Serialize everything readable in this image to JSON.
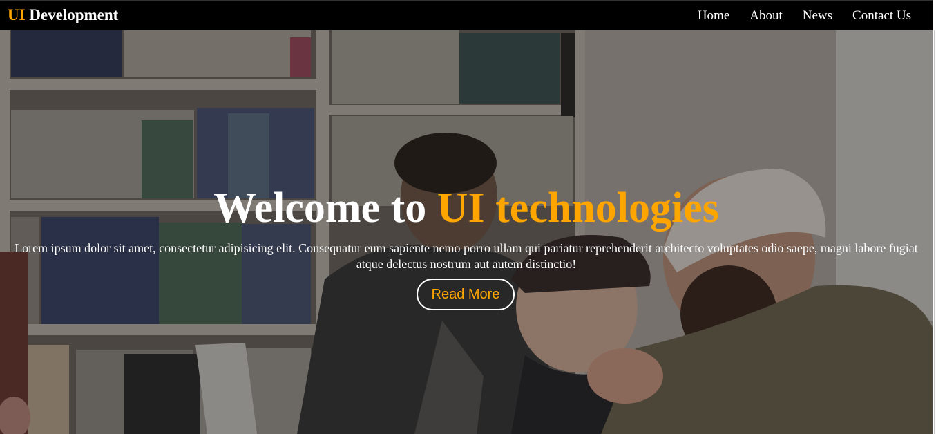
{
  "navbar": {
    "brand_accent": "UI",
    "brand_rest": " Development",
    "links": [
      {
        "label": "Home"
      },
      {
        "label": "About"
      },
      {
        "label": "News"
      },
      {
        "label": "Contact Us"
      }
    ]
  },
  "hero": {
    "headline_prefix": "Welcome to ",
    "headline_accent": "UI technologies",
    "intro": "Lorem ipsum dolor sit amet, consectetur adipisicing elit. Consequatur eum sapiente nemo porro ullam qui pariatur reprehenderit architecto voluptates odio saepe, magni labore fugiat atque delectus nostrum aut autem distinctio!",
    "button_label": "Read More",
    "background_image": "people-laughing-at-laptop-in-library-photo"
  },
  "colors": {
    "accent": "#ffa500",
    "navbar_bg": "#000000",
    "text": "#ffffff"
  }
}
